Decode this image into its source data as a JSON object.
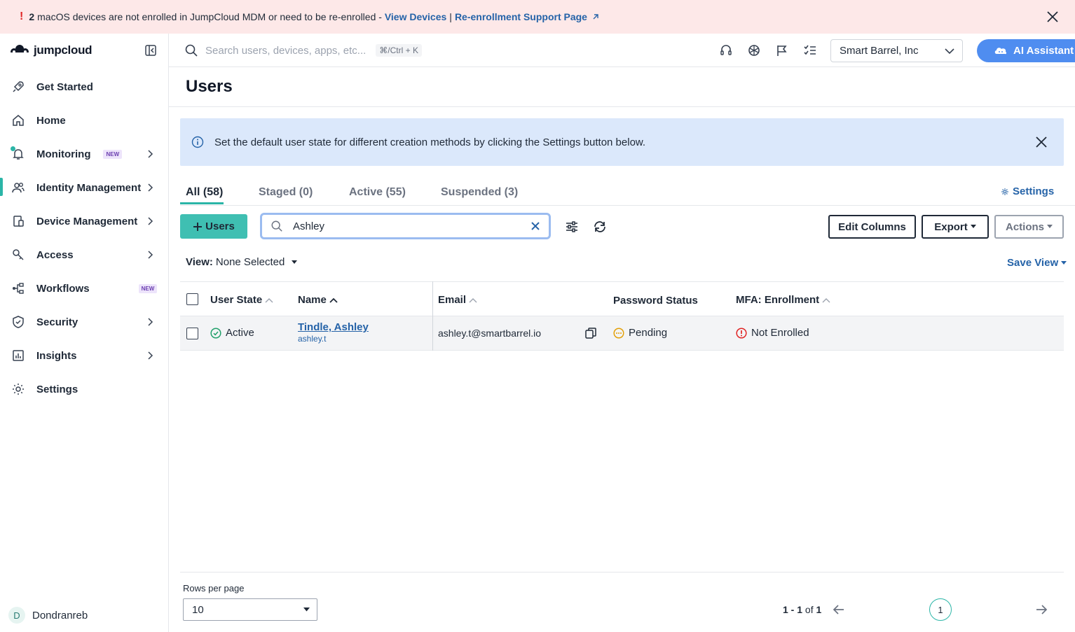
{
  "banner": {
    "bang": "!",
    "count": "2",
    "message": "macOS devices are not enrolled in JumpCloud MDM or need to be re-enrolled -",
    "link_devices": "View Devices",
    "separator": "|",
    "link_support": "Re-enrollment Support Page"
  },
  "sidebar": {
    "logo_text": "jumpcloud",
    "items": [
      {
        "label": "Get Started",
        "icon": "rocket-icon"
      },
      {
        "label": "Home",
        "icon": "home-icon"
      },
      {
        "label": "Monitoring",
        "icon": "bell-icon",
        "badge": "NEW"
      },
      {
        "label": "Identity Management",
        "icon": "users-icon"
      },
      {
        "label": "Device Management",
        "icon": "devices-icon"
      },
      {
        "label": "Access",
        "icon": "key-icon"
      },
      {
        "label": "Workflows",
        "icon": "workflow-icon",
        "badge": "NEW"
      },
      {
        "label": "Security",
        "icon": "shield-icon"
      },
      {
        "label": "Insights",
        "icon": "chart-icon"
      },
      {
        "label": "Settings",
        "icon": "gear-icon"
      }
    ],
    "user_initial": "D",
    "user_name": "Dondranreb"
  },
  "topbar": {
    "search_placeholder": "Search users, devices, apps, etc...",
    "shortcut": "⌘/Ctrl + K",
    "org_name": "Smart Barrel, Inc",
    "ai_label": "AI Assistant"
  },
  "main": {
    "title": "Users",
    "info_text": "Set the default user state for different creation methods by clicking the Settings button below.",
    "tabs": [
      {
        "label": "All (58)"
      },
      {
        "label": "Staged (0)"
      },
      {
        "label": "Active (55)"
      },
      {
        "label": "Suspended (3)"
      }
    ],
    "settings_label": "Settings",
    "add_users_label": "Users",
    "search_value": "Ashley",
    "edit_columns_label": "Edit Columns",
    "export_label": "Export",
    "actions_label": "Actions",
    "view_label": "View:",
    "view_value": "None Selected",
    "save_view_label": "Save View"
  },
  "table": {
    "columns": [
      "User State",
      "Name",
      "Email",
      "Password Status",
      "MFA: Enrollment"
    ],
    "rows": [
      {
        "state": "Active",
        "name": "Tindle, Ashley",
        "username": "ashley.t",
        "email": "ashley.t@smartbarrel.io",
        "password_status": "Pending",
        "mfa": "Not Enrolled"
      }
    ]
  },
  "pagination": {
    "rows_per_page_label": "Rows per page",
    "rows_per_page": "10",
    "range": "1 - 1",
    "of_label": "of",
    "total": "1",
    "current_page": "1"
  },
  "colors": {
    "accent": "#2bb5a7",
    "link": "#2563a8",
    "banner_bg": "#fde8e8",
    "info_bg": "#dbe8fb",
    "ai_bg": "#4f8df0"
  }
}
